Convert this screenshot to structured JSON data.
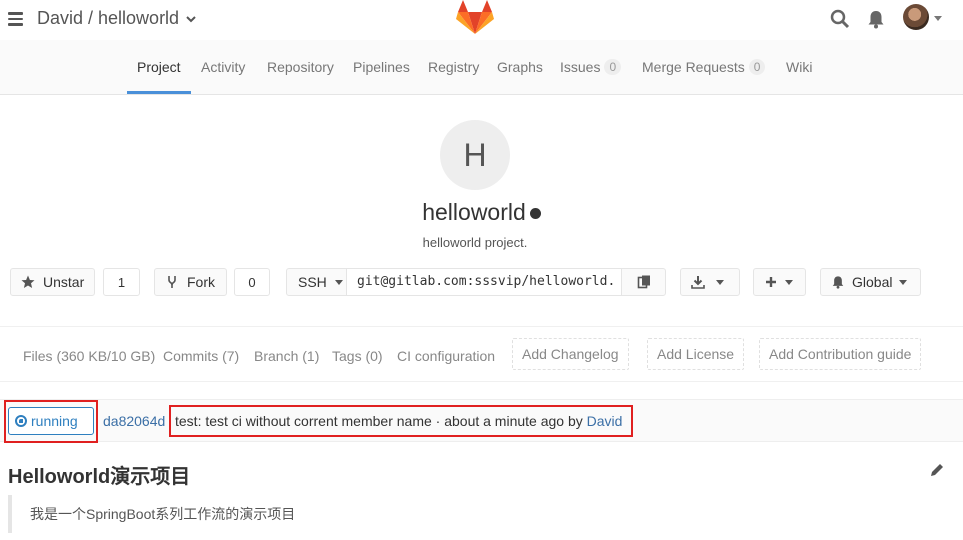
{
  "header": {
    "title": "David / helloworld"
  },
  "nav": {
    "tabs": [
      {
        "label": "Project"
      },
      {
        "label": "Activity"
      },
      {
        "label": "Repository"
      },
      {
        "label": "Pipelines"
      },
      {
        "label": "Registry"
      },
      {
        "label": "Graphs"
      },
      {
        "label": "Issues",
        "badge": "0"
      },
      {
        "label": "Merge Requests",
        "badge": "0"
      },
      {
        "label": "Wiki"
      }
    ]
  },
  "project": {
    "avatar_letter": "H",
    "name": "helloworld",
    "description": "helloworld project."
  },
  "actions": {
    "unstar_label": "Unstar",
    "star_count": "1",
    "fork_label": "Fork",
    "fork_count": "0",
    "clone_protocol": "SSH",
    "clone_url": "git@gitlab.com:sssvip/helloworld.",
    "notification_label": "Global"
  },
  "stats": {
    "files": "Files (360 KB/10 GB)",
    "commits": "Commits (7)",
    "branch": "Branch (1)",
    "tags": "Tags (0)",
    "ci_config": "CI configuration",
    "add_changelog": "Add Changelog",
    "add_license": "Add License",
    "add_contribution": "Add Contribution guide"
  },
  "commit": {
    "status": "running",
    "sha": "da82064d",
    "message": "test: test ci without corrent member name · about a minute ago by ",
    "author": "David"
  },
  "readme": {
    "title": "Helloworld演示项目",
    "quote": "我是一个SpringBoot系列工作流的演示项目"
  },
  "colors": {
    "accent": "#4a90d9",
    "link": "#3b6fa6",
    "highlight_box": "#e02020",
    "running": "#2e7fbf"
  }
}
